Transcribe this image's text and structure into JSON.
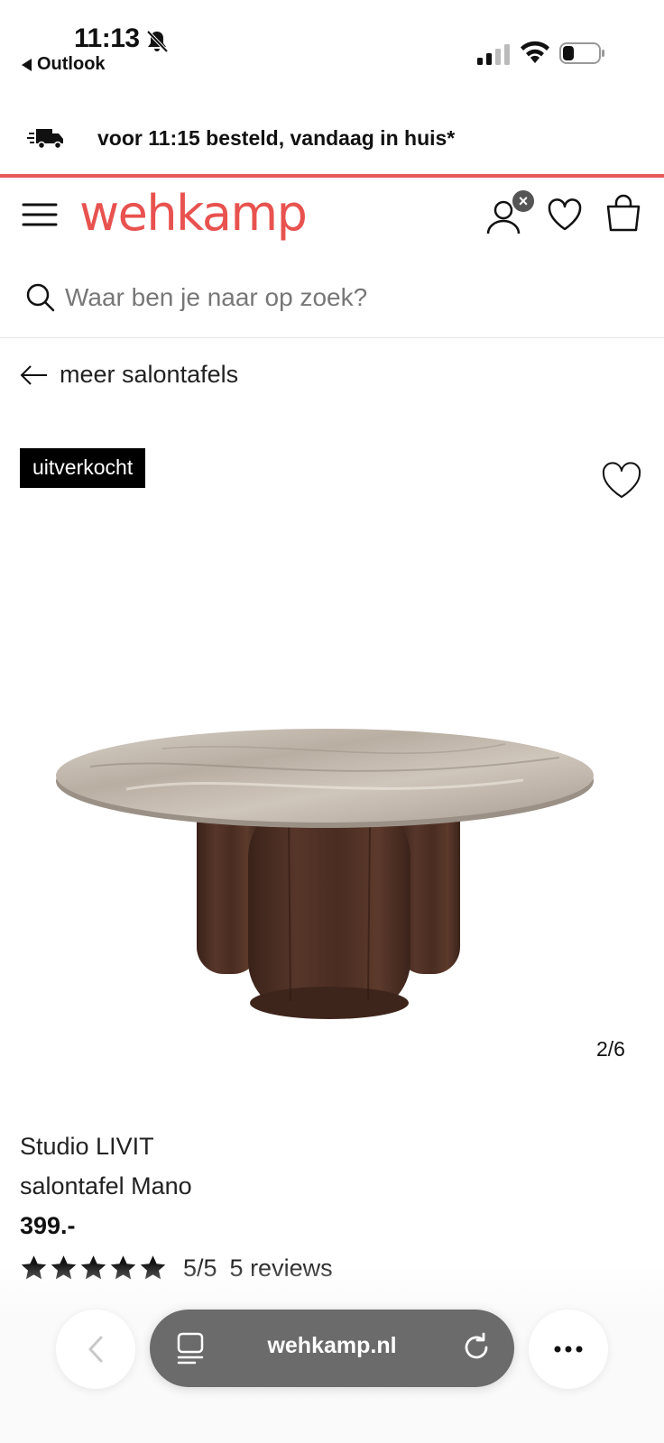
{
  "status_bar": {
    "time": "11:13",
    "back_app": "Outlook"
  },
  "delivery_banner": {
    "text": "voor 11:15 besteld, vandaag in huis*"
  },
  "header": {
    "logo": "wehkamp",
    "accent_color": "#e8524f"
  },
  "search": {
    "placeholder": "Waar ben je naar op zoek?",
    "value": ""
  },
  "breadcrumb": {
    "back_label": "meer salontafels"
  },
  "product": {
    "badge": "uitverkocht",
    "image_counter": "2/6",
    "brand": "Studio LIVIT",
    "name": "salontafel Mano",
    "price": "399.-",
    "rating_score": "5/5",
    "rating_stars": 5,
    "reviews": "5 reviews"
  },
  "browser": {
    "url": "wehkamp.nl"
  }
}
